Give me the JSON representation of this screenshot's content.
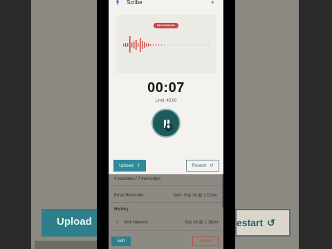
{
  "modal": {
    "title": "Scribe",
    "close_symbol": "×",
    "recording_badge": "RECORDING",
    "timer": "00:07",
    "limit": "Limit: 45:00",
    "upload_label": "Upload",
    "restart_label": "Restart",
    "icons": [
      "mic-icon",
      "close-icon",
      "pause-icon",
      "upload-icon",
      "restart-icon"
    ]
  },
  "background": {
    "upload_label": "Upload",
    "restart_label": "estart"
  },
  "page": {
    "participants_text": "4 countries / 7 transcripts",
    "rows": [
      {
        "key": "Email Reminder",
        "value": "Sent: Sep 24 @ 1:12pm"
      }
    ],
    "history_heading": "History",
    "history": [
      {
        "name": "Nick Nieterra",
        "time": "Sep 24 @ 1:18pm"
      }
    ],
    "edit_label": "Edit",
    "delete_label": "Delete"
  },
  "colors": {
    "accent": "#2d8a9a",
    "record_red": "#c9444a",
    "pause_button": "#1f5a5a"
  }
}
